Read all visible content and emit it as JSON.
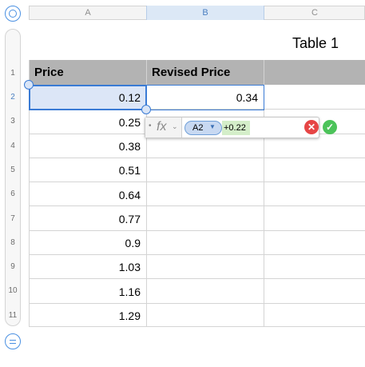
{
  "columns": [
    "A",
    "B",
    "C"
  ],
  "rows": [
    "1",
    "2",
    "3",
    "4",
    "5",
    "6",
    "7",
    "8",
    "9",
    "10",
    "11"
  ],
  "table_title": "Table 1",
  "headers": [
    "Price",
    "Revised Price"
  ],
  "prices": [
    "0.12",
    "0.25",
    "0.38",
    "0.51",
    "0.64",
    "0.77",
    "0.9",
    "1.03",
    "1.16",
    "1.29"
  ],
  "revised": [
    "0.34"
  ],
  "formula": {
    "fx_label": "fx",
    "dot": "•",
    "chevron": "⌄",
    "token": "A2",
    "token_caret": "▼",
    "rest": "+0.22",
    "cancel": "✕",
    "accept": "✓"
  },
  "colors": {
    "accent": "#3a7bd5",
    "header_fill": "#b3b3b3",
    "selection_fill": "#dce6f7",
    "cancel": "#e64545",
    "accept": "#4cc35a"
  }
}
